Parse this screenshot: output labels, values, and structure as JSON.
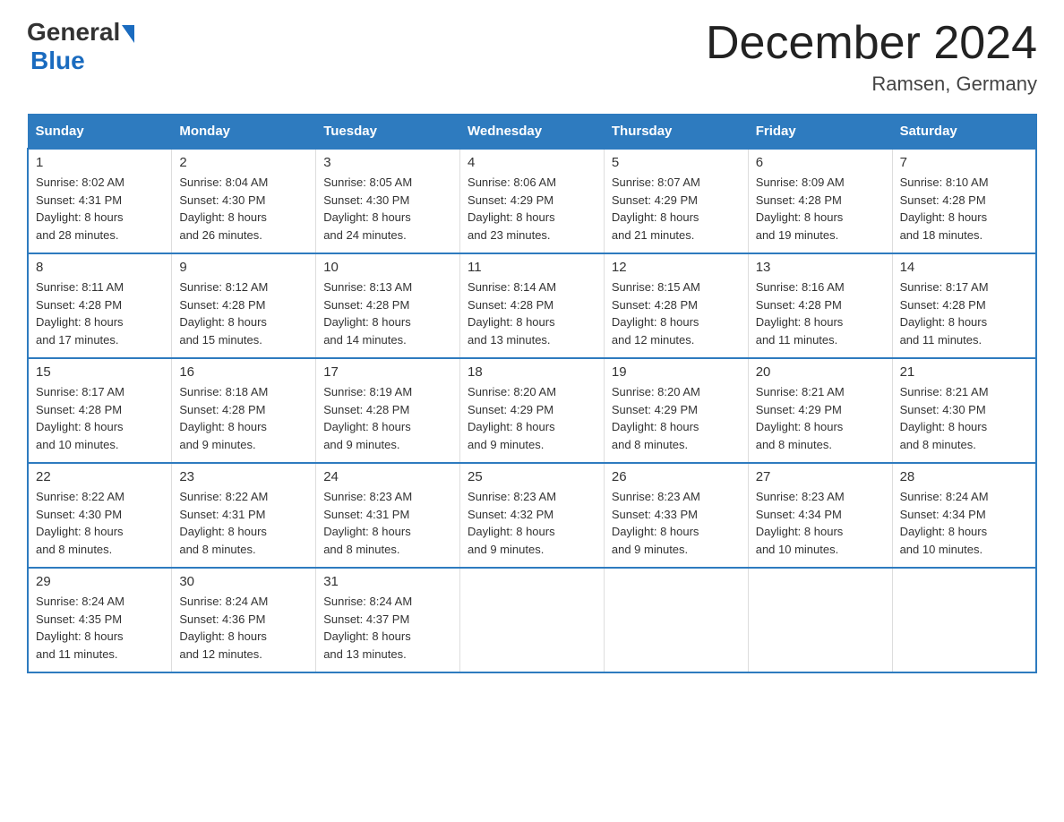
{
  "logo": {
    "general": "General",
    "blue": "Blue"
  },
  "title": "December 2024",
  "location": "Ramsen, Germany",
  "days_of_week": [
    "Sunday",
    "Monday",
    "Tuesday",
    "Wednesday",
    "Thursday",
    "Friday",
    "Saturday"
  ],
  "weeks": [
    [
      {
        "day": "1",
        "sunrise": "8:02 AM",
        "sunset": "4:31 PM",
        "daylight": "8 hours and 28 minutes."
      },
      {
        "day": "2",
        "sunrise": "8:04 AM",
        "sunset": "4:30 PM",
        "daylight": "8 hours and 26 minutes."
      },
      {
        "day": "3",
        "sunrise": "8:05 AM",
        "sunset": "4:30 PM",
        "daylight": "8 hours and 24 minutes."
      },
      {
        "day": "4",
        "sunrise": "8:06 AM",
        "sunset": "4:29 PM",
        "daylight": "8 hours and 23 minutes."
      },
      {
        "day": "5",
        "sunrise": "8:07 AM",
        "sunset": "4:29 PM",
        "daylight": "8 hours and 21 minutes."
      },
      {
        "day": "6",
        "sunrise": "8:09 AM",
        "sunset": "4:28 PM",
        "daylight": "8 hours and 19 minutes."
      },
      {
        "day": "7",
        "sunrise": "8:10 AM",
        "sunset": "4:28 PM",
        "daylight": "8 hours and 18 minutes."
      }
    ],
    [
      {
        "day": "8",
        "sunrise": "8:11 AM",
        "sunset": "4:28 PM",
        "daylight": "8 hours and 17 minutes."
      },
      {
        "day": "9",
        "sunrise": "8:12 AM",
        "sunset": "4:28 PM",
        "daylight": "8 hours and 15 minutes."
      },
      {
        "day": "10",
        "sunrise": "8:13 AM",
        "sunset": "4:28 PM",
        "daylight": "8 hours and 14 minutes."
      },
      {
        "day": "11",
        "sunrise": "8:14 AM",
        "sunset": "4:28 PM",
        "daylight": "8 hours and 13 minutes."
      },
      {
        "day": "12",
        "sunrise": "8:15 AM",
        "sunset": "4:28 PM",
        "daylight": "8 hours and 12 minutes."
      },
      {
        "day": "13",
        "sunrise": "8:16 AM",
        "sunset": "4:28 PM",
        "daylight": "8 hours and 11 minutes."
      },
      {
        "day": "14",
        "sunrise": "8:17 AM",
        "sunset": "4:28 PM",
        "daylight": "8 hours and 11 minutes."
      }
    ],
    [
      {
        "day": "15",
        "sunrise": "8:17 AM",
        "sunset": "4:28 PM",
        "daylight": "8 hours and 10 minutes."
      },
      {
        "day": "16",
        "sunrise": "8:18 AM",
        "sunset": "4:28 PM",
        "daylight": "8 hours and 9 minutes."
      },
      {
        "day": "17",
        "sunrise": "8:19 AM",
        "sunset": "4:28 PM",
        "daylight": "8 hours and 9 minutes."
      },
      {
        "day": "18",
        "sunrise": "8:20 AM",
        "sunset": "4:29 PM",
        "daylight": "8 hours and 9 minutes."
      },
      {
        "day": "19",
        "sunrise": "8:20 AM",
        "sunset": "4:29 PM",
        "daylight": "8 hours and 8 minutes."
      },
      {
        "day": "20",
        "sunrise": "8:21 AM",
        "sunset": "4:29 PM",
        "daylight": "8 hours and 8 minutes."
      },
      {
        "day": "21",
        "sunrise": "8:21 AM",
        "sunset": "4:30 PM",
        "daylight": "8 hours and 8 minutes."
      }
    ],
    [
      {
        "day": "22",
        "sunrise": "8:22 AM",
        "sunset": "4:30 PM",
        "daylight": "8 hours and 8 minutes."
      },
      {
        "day": "23",
        "sunrise": "8:22 AM",
        "sunset": "4:31 PM",
        "daylight": "8 hours and 8 minutes."
      },
      {
        "day": "24",
        "sunrise": "8:23 AM",
        "sunset": "4:31 PM",
        "daylight": "8 hours and 8 minutes."
      },
      {
        "day": "25",
        "sunrise": "8:23 AM",
        "sunset": "4:32 PM",
        "daylight": "8 hours and 9 minutes."
      },
      {
        "day": "26",
        "sunrise": "8:23 AM",
        "sunset": "4:33 PM",
        "daylight": "8 hours and 9 minutes."
      },
      {
        "day": "27",
        "sunrise": "8:23 AM",
        "sunset": "4:34 PM",
        "daylight": "8 hours and 10 minutes."
      },
      {
        "day": "28",
        "sunrise": "8:24 AM",
        "sunset": "4:34 PM",
        "daylight": "8 hours and 10 minutes."
      }
    ],
    [
      {
        "day": "29",
        "sunrise": "8:24 AM",
        "sunset": "4:35 PM",
        "daylight": "8 hours and 11 minutes."
      },
      {
        "day": "30",
        "sunrise": "8:24 AM",
        "sunset": "4:36 PM",
        "daylight": "8 hours and 12 minutes."
      },
      {
        "day": "31",
        "sunrise": "8:24 AM",
        "sunset": "4:37 PM",
        "daylight": "8 hours and 13 minutes."
      },
      null,
      null,
      null,
      null
    ]
  ],
  "labels": {
    "sunrise": "Sunrise:",
    "sunset": "Sunset:",
    "daylight": "Daylight:"
  }
}
